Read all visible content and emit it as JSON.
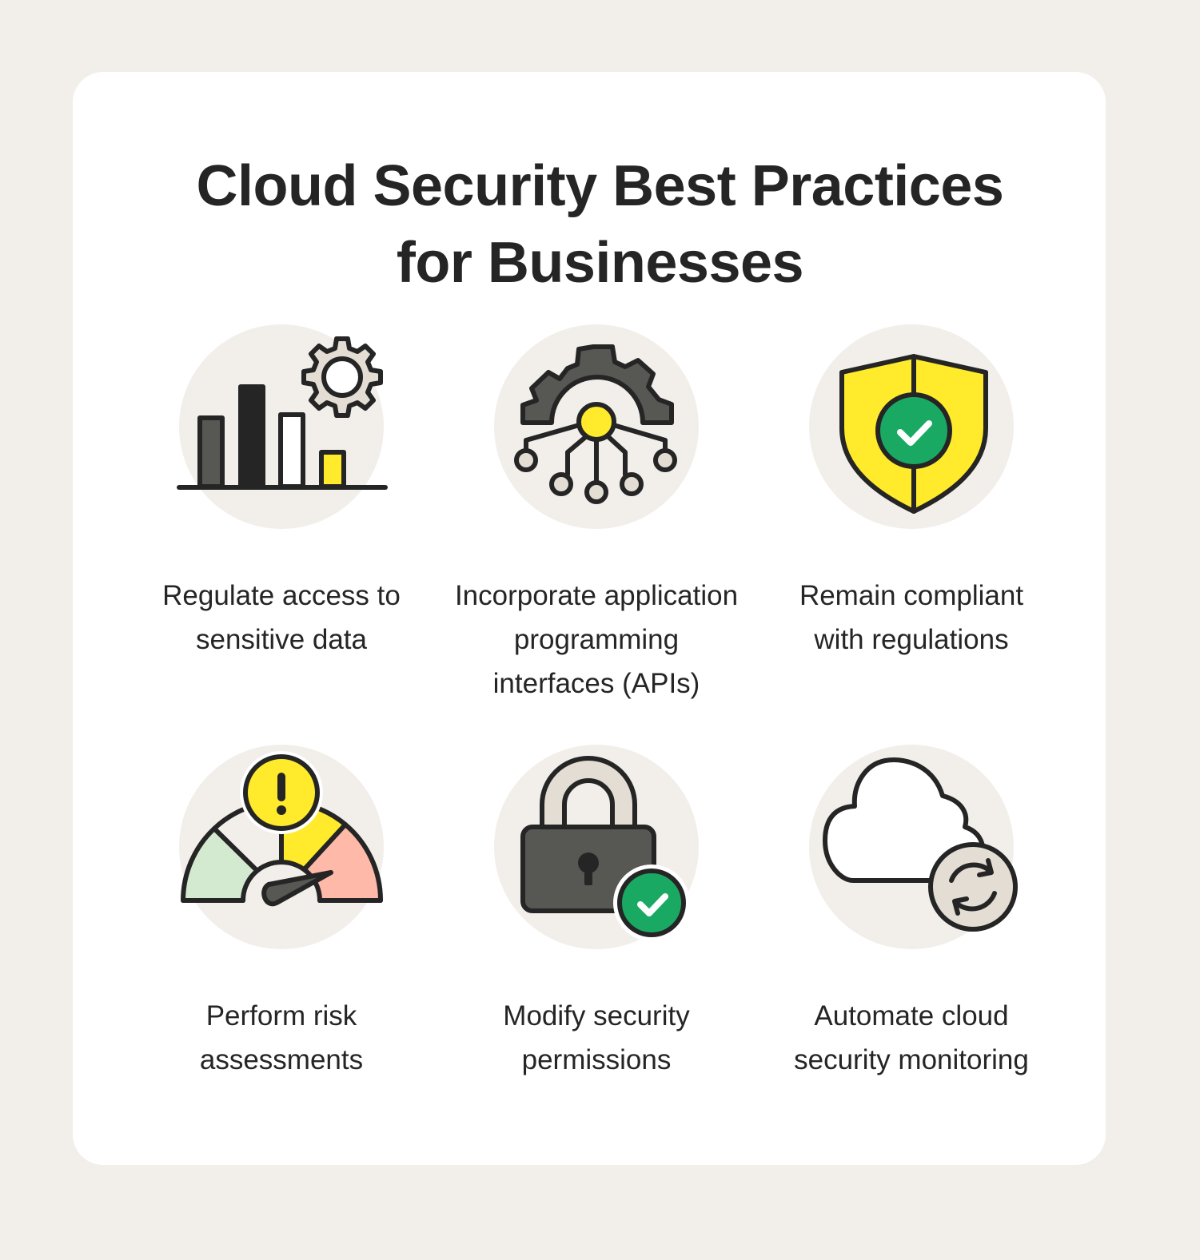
{
  "title": {
    "line1": "Cloud Security Best Practices",
    "line2": "for Businesses"
  },
  "colors": {
    "page_background": "#F2EFEB",
    "card_background": "#FFFFFF",
    "icon_circle": "#F2EFEB",
    "text": "#252525",
    "outline": "#252525",
    "yellow": "#FFEA2B",
    "green": "#1AA963",
    "dark_gray": "#575853",
    "beige": "#E3DDD3",
    "light_green": "#D4EAD0",
    "salmon": "#FEB9A8"
  },
  "practices": [
    {
      "icon": "bar-chart-gear-icon",
      "lines": [
        "Regulate access to",
        "sensitive data"
      ]
    },
    {
      "icon": "gear-network-icon",
      "lines": [
        "Incorporate application",
        "programming",
        "interfaces (APIs)"
      ]
    },
    {
      "icon": "shield-check-icon",
      "lines": [
        "Remain compliant",
        "with regulations"
      ]
    },
    {
      "icon": "risk-gauge-icon",
      "lines": [
        "Perform risk",
        "assessments"
      ]
    },
    {
      "icon": "padlock-check-icon",
      "lines": [
        "Modify security",
        "permissions"
      ]
    },
    {
      "icon": "cloud-sync-icon",
      "lines": [
        "Automate cloud",
        "security monitoring"
      ]
    }
  ]
}
